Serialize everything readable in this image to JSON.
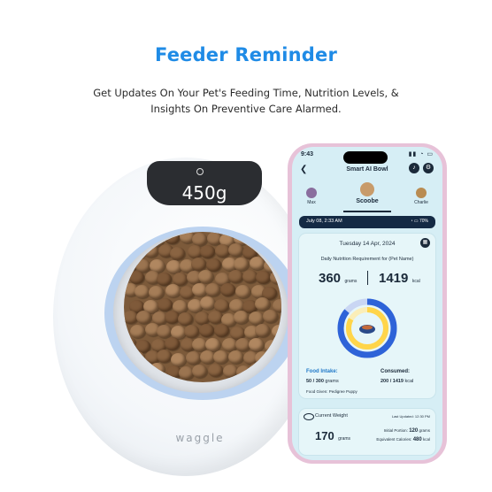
{
  "headline": "Feeder Reminder",
  "subline": "Get Updates On Your Pet's Feeding Time, Nutrition Levels, & Insights On Preventive Care Alarmed.",
  "feeder": {
    "weight": "450g",
    "brand": "waggle"
  },
  "phone": {
    "status_time": "9:43",
    "status_icons": "▮▮ ◔ ▭",
    "back_icon": "❮",
    "title": "Smart AI Bowl",
    "pets": [
      {
        "name": "Max"
      },
      {
        "name": "Scoobe"
      },
      {
        "name": "Charlie"
      }
    ],
    "datetime": "July 08, 2:33 AM",
    "status_bar_right": "◔ ▭ 70%",
    "date": "Tuesday 14 Apr, 2024",
    "requirement": "Daily Nutrition Requirement for (Pet Name)",
    "grams_value": "360",
    "grams_unit": "grams",
    "kcal_value": "1419",
    "kcal_unit": "kcal",
    "food_intake_label": "Food Intake:",
    "food_intake_value": "50 / 300",
    "food_intake_unit": "grams",
    "consumed_label": "Consumed:",
    "consumed_value": "200 / 1419",
    "consumed_unit": "kcal",
    "food_given": "Food Given: Pedigree Puppy",
    "current_weight_label": "Current Weight",
    "last_updated": "Last Updated: 12:30 PM",
    "weight_value": "170",
    "weight_unit": "grams",
    "initial_portion_label": "Initial Portion:",
    "initial_portion_value": "120",
    "initial_portion_unit": "grams",
    "equiv_calories_label": "Equivalent Calories:",
    "equiv_calories_value": "480",
    "equiv_calories_unit": "kcal",
    "intake_progress": 0.17,
    "consumed_progress": 0.14
  },
  "colors": {
    "accent": "#1f8be6",
    "donut_outer": "#2e63d8",
    "donut_inner": "#ffd54a"
  }
}
